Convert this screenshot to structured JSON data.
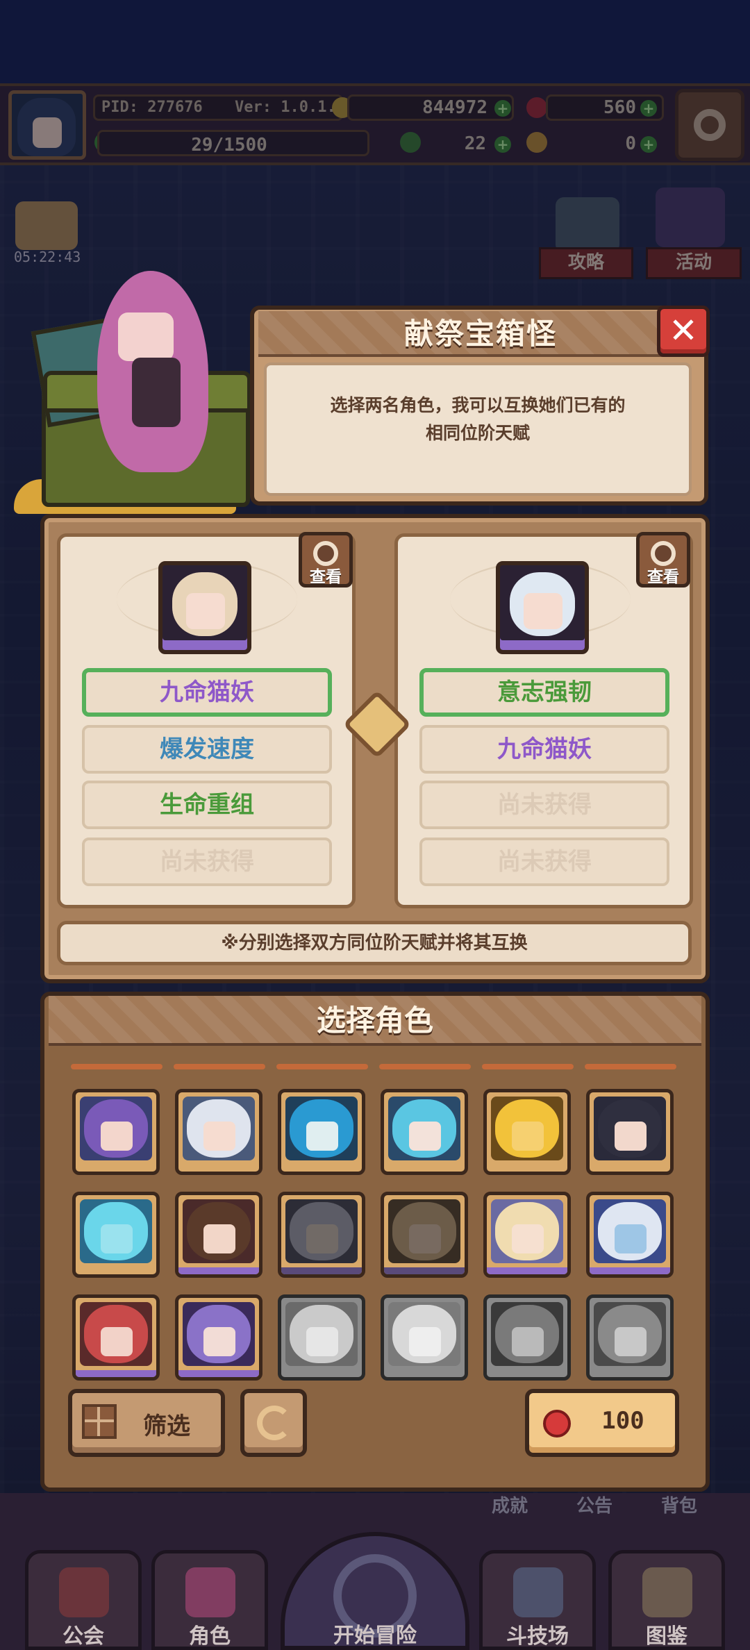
{
  "hud": {
    "pid": "PID: 277676",
    "version": "Ver: 1.0.1.8",
    "gold": "844972",
    "gems": "560",
    "xp": "29/1500",
    "clover": "22",
    "keys": "0",
    "timer": "05:22:43"
  },
  "side_buttons": {
    "guide": "攻略",
    "event": "活动",
    "achievement": "成就",
    "notice": "公告",
    "bag": "背包"
  },
  "dialog": {
    "title": "献祭宝箱怪",
    "description_line1": "选择两名角色，我可以互换她们已有的",
    "description_line2": "相同位阶天赋",
    "close_symbol": "✕"
  },
  "swap": {
    "view_label": "查看",
    "left_talents": [
      {
        "label": "九命猫妖",
        "color": "purple",
        "selected": true
      },
      {
        "label": "爆发速度",
        "color": "blue",
        "selected": false
      },
      {
        "label": "生命重组",
        "color": "green",
        "selected": false
      },
      {
        "label": "尚未获得",
        "color": "empty",
        "selected": false
      }
    ],
    "right_talents": [
      {
        "label": "意志强韧",
        "color": "green",
        "selected": true
      },
      {
        "label": "九命猫妖",
        "color": "purple",
        "selected": false
      },
      {
        "label": "尚未获得",
        "color": "empty",
        "selected": false
      },
      {
        "label": "尚未获得",
        "color": "empty",
        "selected": false
      }
    ],
    "note": "※分别选择双方同位阶天赋并将其互换"
  },
  "select": {
    "title": "选择角色",
    "filter_label": "筛选",
    "cost_value": "100"
  },
  "nav": {
    "guild": "公会",
    "characters": "角色",
    "adventure": "开始冒险",
    "arena": "斗技场",
    "codex": "图鉴"
  },
  "colors": {
    "talent_purple": "#8e58c9",
    "talent_blue": "#3f88b8",
    "talent_green": "#4a9a3a",
    "talent_empty": "#dccab6",
    "selected_border": "#56b05a",
    "close_red": "#d6403a"
  }
}
